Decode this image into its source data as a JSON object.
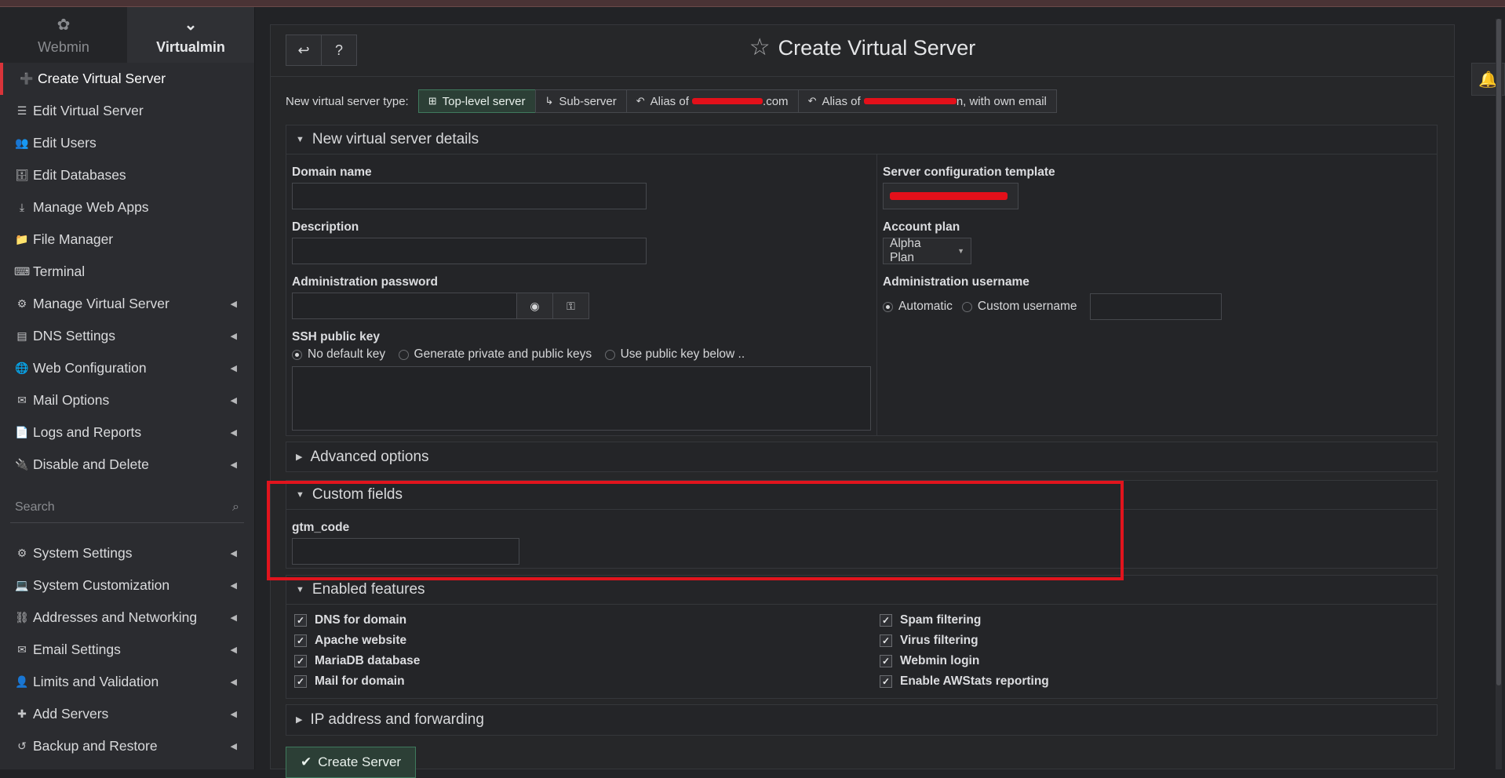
{
  "sidebar": {
    "switch": {
      "webmin_label": "Webmin",
      "virtualmin_label": "Virtualmin",
      "webmin_icon": "webmin-logo-icon",
      "virtualmin_icon": "virtualmin-logo-icon"
    },
    "items": [
      {
        "label": "Create Virtual Server",
        "icon": "➕",
        "active": true,
        "caret": false
      },
      {
        "label": "Edit Virtual Server",
        "icon": "☰",
        "caret": false
      },
      {
        "label": "Edit Users",
        "icon": "👥",
        "caret": false
      },
      {
        "label": "Edit Databases",
        "icon": "🗄",
        "caret": false
      },
      {
        "label": "Manage Web Apps",
        "icon": "⤓",
        "caret": false
      },
      {
        "label": "File Manager",
        "icon": "📁",
        "caret": false
      },
      {
        "label": "Terminal",
        "icon": "⌨",
        "caret": false
      },
      {
        "label": "Manage Virtual Server",
        "icon": "⚙",
        "caret": true
      },
      {
        "label": "DNS Settings",
        "icon": "▤",
        "caret": true
      },
      {
        "label": "Web Configuration",
        "icon": "🌐",
        "caret": true
      },
      {
        "label": "Mail Options",
        "icon": "✉",
        "caret": true
      },
      {
        "label": "Logs and Reports",
        "icon": "📄",
        "caret": true
      },
      {
        "label": "Disable and Delete",
        "icon": "🔌",
        "caret": true
      }
    ],
    "search_placeholder": "Search",
    "system_items": [
      {
        "label": "System Settings",
        "icon": "⚙"
      },
      {
        "label": "System Customization",
        "icon": "💻"
      },
      {
        "label": "Addresses and Networking",
        "icon": "⛓"
      },
      {
        "label": "Email Settings",
        "icon": "✉"
      },
      {
        "label": "Limits and Validation",
        "icon": "👤"
      },
      {
        "label": "Add Servers",
        "icon": "✚"
      },
      {
        "label": "Backup and Restore",
        "icon": "↺"
      }
    ]
  },
  "header": {
    "title": "Create Virtual Server",
    "back_icon": "back-arrow-icon",
    "help_icon": "help-icon"
  },
  "server_type": {
    "label": "New virtual server type:",
    "options": [
      {
        "label": "Top-level server",
        "selected": true
      },
      {
        "label": "Sub-server"
      },
      {
        "label_prefix": "Alias of",
        "label_suffix": ".com"
      },
      {
        "label_prefix": "Alias of",
        "label_suffix": "n, with own email"
      }
    ]
  },
  "details": {
    "title": "New virtual server details",
    "domain_name_label": "Domain name",
    "domain_name_value": "",
    "description_label": "Description",
    "description_value": "",
    "admin_password_label": "Administration password",
    "admin_password_value": "",
    "ssh_key_label": "SSH public key",
    "ssh_key_options": [
      "No default key",
      "Generate private and public keys",
      "Use public key below .."
    ],
    "ssh_key_selected": "No default key",
    "template_label": "Server configuration template",
    "account_plan_label": "Account plan",
    "account_plan_value": "Alpha Plan",
    "admin_username_label": "Administration username",
    "admin_username_options": [
      "Automatic",
      "Custom username"
    ],
    "admin_username_selected": "Automatic"
  },
  "advanced": {
    "title": "Advanced options"
  },
  "custom_fields": {
    "title": "Custom fields",
    "field_label": "gtm_code",
    "field_value": ""
  },
  "features": {
    "title": "Enabled features",
    "left": [
      "DNS for domain",
      "Apache website",
      "MariaDB database",
      "Mail for domain"
    ],
    "right": [
      "Spam filtering",
      "Virus filtering",
      "Webmin login",
      "Enable AWStats reporting"
    ]
  },
  "ip": {
    "title": "IP address and forwarding"
  },
  "create_button": "Create Server",
  "colors": {
    "accent_red": "#e1141d",
    "accent_green": "#3f7a5d"
  }
}
